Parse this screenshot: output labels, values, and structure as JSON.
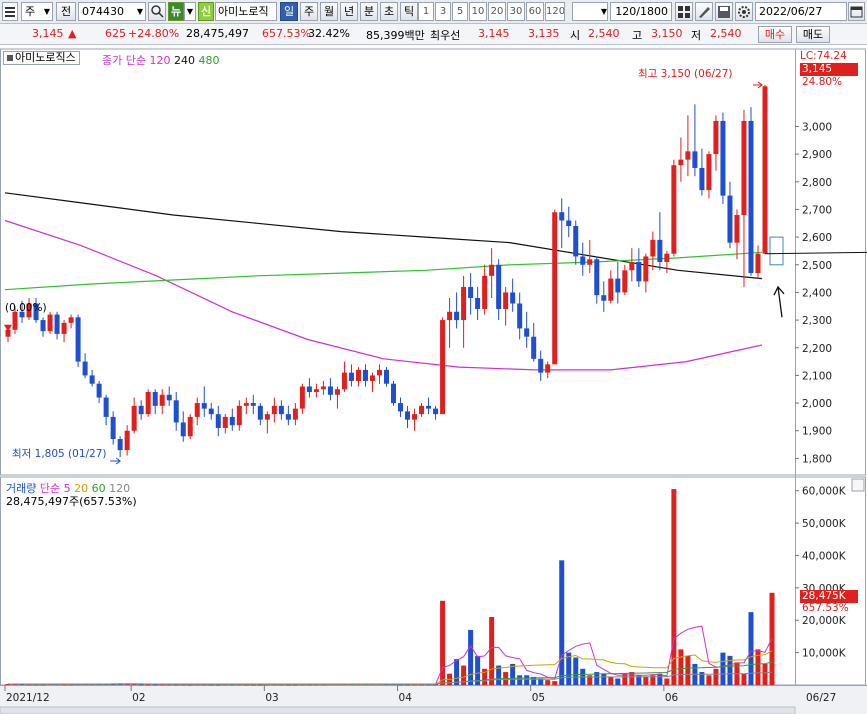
{
  "toolbar": {
    "market": "주",
    "prev": "전",
    "code": "074430",
    "news_label": "뉴",
    "new_label": "신",
    "stock_name": "아미노로직",
    "periods": [
      "일",
      "주",
      "월",
      "년",
      "분",
      "초",
      "틱"
    ],
    "active_period": "일",
    "intervals": [
      "1",
      "3",
      "5",
      "10",
      "20",
      "30",
      "60",
      "120"
    ],
    "count": "120/1800",
    "date": "2022/06/27"
  },
  "info": {
    "price": "3,145",
    "change": "625",
    "change_pct": "+24.80%",
    "volume": "28,475,497",
    "volume_ratio": "657.53%",
    "turnover": "32.42%",
    "amount": "85,399백만",
    "pref_label": "최우선",
    "ask": "3,145",
    "bid": "3,135",
    "open_label": "시",
    "open": "2,540",
    "high_label": "고",
    "high": "3,150",
    "low_label": "저",
    "low": "2,540",
    "buy_label": "매수",
    "sell_label": "매도"
  },
  "price_panel": {
    "name": "아미노로직스",
    "ma_label": "종가 단순",
    "ma_periods": [
      "120",
      "240",
      "480"
    ],
    "lc_label": "LC:74.24",
    "last_price_tag": "3,145",
    "last_pct_tag": "24.80%",
    "high_annotation": "최고 3,150 (06/27)",
    "low_annotation": "최저 1,805 (01/27)",
    "left_marker": "(0.00%)"
  },
  "volume_panel": {
    "title": "거래량",
    "ma_label": "단순",
    "ma_periods": [
      "5",
      "20",
      "60",
      "120"
    ],
    "summary": "28,475,497주(657.53%)",
    "last_tag": "28,475K",
    "last_pct_tag": "657.53%"
  },
  "chart_data": [
    {
      "type": "candlestick",
      "title": "아미노로직스",
      "y_ticks": [
        1800,
        1900,
        2000,
        2100,
        2200,
        2300,
        2400,
        2500,
        2600,
        2700,
        2800,
        2900,
        3000
      ],
      "y_tick_labels": [
        "1,800",
        "1,900",
        "2,000",
        "2,100",
        "2,200",
        "2,300",
        "2,400",
        "2,500",
        "2,600",
        "2,700",
        "2,800",
        "2,900",
        "3,000"
      ],
      "ylim": [
        1740,
        3280
      ],
      "x_ticks": [
        "2021/12",
        "02",
        "03",
        "04",
        "05",
        "06",
        "06/27"
      ],
      "x_tick_index": [
        0,
        18,
        37,
        56,
        75,
        94,
        116
      ],
      "candles": [
        [
          2240,
          2280,
          2220,
          2265
        ],
        [
          2265,
          2350,
          2250,
          2330
        ],
        [
          2330,
          2370,
          2290,
          2310
        ],
        [
          2310,
          2380,
          2300,
          2360
        ],
        [
          2360,
          2380,
          2290,
          2300
        ],
        [
          2300,
          2310,
          2240,
          2260
        ],
        [
          2260,
          2330,
          2250,
          2320
        ],
        [
          2320,
          2330,
          2230,
          2250
        ],
        [
          2250,
          2300,
          2220,
          2290
        ],
        [
          2290,
          2320,
          2270,
          2310
        ],
        [
          2310,
          2320,
          2130,
          2150
        ],
        [
          2150,
          2180,
          2090,
          2100
        ],
        [
          2100,
          2120,
          2060,
          2070
        ],
        [
          2070,
          2080,
          2000,
          2020
        ],
        [
          2020,
          2030,
          1920,
          1950
        ],
        [
          1950,
          1970,
          1850,
          1870
        ],
        [
          1870,
          1880,
          1805,
          1830
        ],
        [
          1830,
          1920,
          1810,
          1900
        ],
        [
          1900,
          2020,
          1890,
          1990
        ],
        [
          1990,
          2010,
          1940,
          1960
        ],
        [
          1960,
          2050,
          1950,
          2040
        ],
        [
          2040,
          2050,
          1960,
          1990
        ],
        [
          1990,
          2050,
          1960,
          2030
        ],
        [
          2030,
          2060,
          1990,
          2010
        ],
        [
          2010,
          2040,
          1900,
          1930
        ],
        [
          1930,
          1970,
          1860,
          1880
        ],
        [
          1880,
          1960,
          1870,
          1950
        ],
        [
          1950,
          2020,
          1920,
          2000
        ],
        [
          2000,
          2060,
          1950,
          1980
        ],
        [
          1980,
          2000,
          1940,
          1960
        ],
        [
          1960,
          1990,
          1880,
          1910
        ],
        [
          1910,
          1960,
          1890,
          1950
        ],
        [
          1950,
          1980,
          1900,
          1920
        ],
        [
          1920,
          2010,
          1900,
          1990
        ],
        [
          1990,
          2020,
          1960,
          2000
        ],
        [
          2000,
          2030,
          1960,
          1990
        ],
        [
          1990,
          2000,
          1920,
          1940
        ],
        [
          1940,
          1970,
          1890,
          1960
        ],
        [
          1960,
          2020,
          1930,
          1990
        ],
        [
          1990,
          2010,
          1940,
          1960
        ],
        [
          1960,
          1990,
          1920,
          1940
        ],
        [
          1940,
          2000,
          1920,
          1980
        ],
        [
          1980,
          2070,
          1960,
          2060
        ],
        [
          2060,
          2090,
          2020,
          2040
        ],
        [
          2040,
          2070,
          2020,
          2050
        ],
        [
          2050,
          2080,
          2030,
          2060
        ],
        [
          2060,
          2090,
          2010,
          2030
        ],
        [
          2030,
          2060,
          1980,
          2050
        ],
        [
          2050,
          2150,
          2040,
          2110
        ],
        [
          2110,
          2140,
          2060,
          2080
        ],
        [
          2080,
          2130,
          2060,
          2120
        ],
        [
          2120,
          2140,
          2060,
          2080
        ],
        [
          2080,
          2110,
          2040,
          2100
        ],
        [
          2100,
          2140,
          2070,
          2120
        ],
        [
          2120,
          2130,
          2060,
          2070
        ],
        [
          2070,
          2080,
          1990,
          2000
        ],
        [
          2000,
          2020,
          1950,
          1970
        ],
        [
          1970,
          1990,
          1910,
          1940
        ],
        [
          1940,
          1980,
          1900,
          1960
        ],
        [
          1960,
          2000,
          1950,
          1990
        ],
        [
          1990,
          2020,
          1960,
          1980
        ],
        [
          1980,
          1990,
          1940,
          1960
        ],
        [
          1960,
          2310,
          1960,
          2300
        ],
        [
          2300,
          2380,
          2200,
          2330
        ],
        [
          2330,
          2400,
          2270,
          2300
        ],
        [
          2300,
          2460,
          2200,
          2420
        ],
        [
          2420,
          2470,
          2320,
          2380
        ],
        [
          2380,
          2420,
          2300,
          2340
        ],
        [
          2340,
          2500,
          2320,
          2460
        ],
        [
          2460,
          2560,
          2380,
          2500
        ],
        [
          2500,
          2520,
          2300,
          2340
        ],
        [
          2340,
          2420,
          2280,
          2400
        ],
        [
          2400,
          2450,
          2330,
          2360
        ],
        [
          2360,
          2400,
          2230,
          2270
        ],
        [
          2270,
          2330,
          2200,
          2240
        ],
        [
          2240,
          2290,
          2150,
          2160
        ],
        [
          2160,
          2190,
          2080,
          2110
        ],
        [
          2110,
          2150,
          2090,
          2140
        ],
        [
          2140,
          2700,
          2140,
          2690
        ],
        [
          2690,
          2740,
          2560,
          2660
        ],
        [
          2660,
          2710,
          2600,
          2640
        ],
        [
          2640,
          2660,
          2500,
          2530
        ],
        [
          2530,
          2580,
          2460,
          2500
        ],
        [
          2500,
          2590,
          2470,
          2520
        ],
        [
          2520,
          2530,
          2360,
          2390
        ],
        [
          2390,
          2440,
          2330,
          2370
        ],
        [
          2370,
          2480,
          2360,
          2450
        ],
        [
          2450,
          2510,
          2360,
          2400
        ],
        [
          2400,
          2500,
          2390,
          2480
        ],
        [
          2480,
          2560,
          2440,
          2510
        ],
        [
          2510,
          2560,
          2420,
          2440
        ],
        [
          2440,
          2540,
          2400,
          2530
        ],
        [
          2530,
          2620,
          2480,
          2590
        ],
        [
          2590,
          2690,
          2480,
          2510
        ],
        [
          2510,
          2550,
          2470,
          2540
        ],
        [
          2540,
          2880,
          2530,
          2860
        ],
        [
          2860,
          2960,
          2800,
          2880
        ],
        [
          2880,
          3040,
          2820,
          2910
        ],
        [
          2910,
          3080,
          2820,
          2850
        ],
        [
          2850,
          2920,
          2750,
          2770
        ],
        [
          2770,
          2910,
          2740,
          2900
        ],
        [
          2900,
          3040,
          2840,
          3020
        ],
        [
          3020,
          3050,
          2720,
          2750
        ],
        [
          2750,
          2800,
          2560,
          2580
        ],
        [
          2580,
          2700,
          2520,
          2680
        ],
        [
          2680,
          3060,
          2420,
          3020
        ],
        [
          3020,
          3070,
          2460,
          2470
        ],
        [
          2470,
          2570,
          2450,
          2540
        ],
        [
          2540,
          3150,
          2540,
          3145
        ]
      ],
      "ma_series": [
        {
          "name": "120",
          "color": "#d030d0",
          "values": [
            2660,
            2570,
            2460,
            2330,
            2230,
            2160,
            2130,
            2120,
            2120,
            2150,
            2210
          ]
        },
        {
          "name": "240",
          "color": "#111111",
          "values": [
            2760,
            2720,
            2680,
            2650,
            2620,
            2600,
            2580,
            2530,
            2480,
            2450
          ]
        },
        {
          "name": "480",
          "color": "#30c030",
          "values": [
            2410,
            2430,
            2445,
            2460,
            2470,
            2480,
            2500,
            2510,
            2525,
            2545
          ]
        }
      ]
    },
    {
      "type": "bar",
      "title": "거래량",
      "y_ticks": [
        10000,
        20000,
        30000,
        40000,
        50000,
        60000
      ],
      "y_tick_labels": [
        "10,000K",
        "20,000K",
        "30,000K",
        "40,000K",
        "50,000K",
        "60,000K"
      ],
      "ylim": [
        0,
        63000
      ],
      "values": [
        300,
        300,
        300,
        250,
        250,
        250,
        300,
        300,
        250,
        250,
        300,
        300,
        300,
        300,
        350,
        400,
        450,
        300,
        300,
        250,
        250,
        250,
        250,
        250,
        250,
        250,
        200,
        250,
        250,
        200,
        200,
        250,
        250,
        250,
        200,
        200,
        200,
        250,
        250,
        250,
        200,
        200,
        250,
        250,
        250,
        250,
        300,
        300,
        350,
        300,
        300,
        300,
        300,
        300,
        300,
        300,
        250,
        250,
        250,
        250,
        250,
        250,
        26000,
        3500,
        8000,
        6000,
        17000,
        9000,
        5000,
        21000,
        6000,
        4000,
        6500,
        3000,
        3000,
        2500,
        2000,
        1500,
        1200,
        38500,
        10000,
        8500,
        5000,
        3000,
        4000,
        3500,
        2500,
        2000,
        3500,
        4000,
        3000,
        2500,
        3000,
        3500,
        2000,
        60500,
        11000,
        9000,
        6500,
        4000,
        3000,
        5000,
        10000,
        9000,
        7000,
        3500,
        22500,
        11000,
        6500,
        28475
      ],
      "ma_series": [
        {
          "name": "5",
          "color": "#d030d0"
        },
        {
          "name": "20",
          "color": "#d0a000"
        },
        {
          "name": "60",
          "color": "#30a030"
        },
        {
          "name": "120",
          "color": "#888888"
        }
      ]
    }
  ]
}
